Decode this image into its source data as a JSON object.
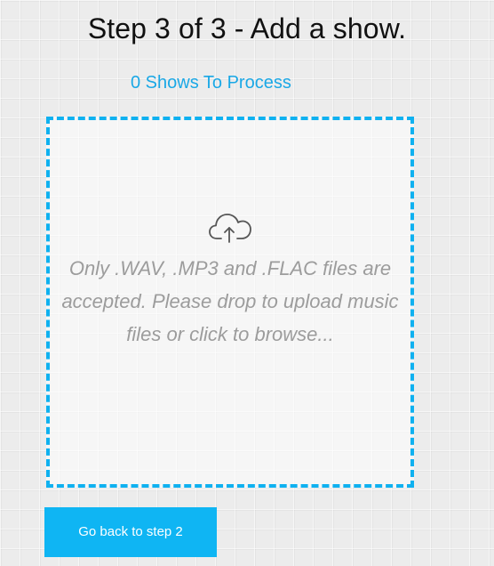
{
  "header": {
    "title": "Step 3 of 3 - Add a show.",
    "shows_count": "0 Shows To Process"
  },
  "dropzone": {
    "icon": "cloud-upload-icon",
    "message": "Only .WAV, .MP3 and .FLAC files are accepted. Please drop to upload music files or click to browse..."
  },
  "footer": {
    "back_button_label": "Go back to step 2"
  },
  "colors": {
    "accent": "#0fb5f3",
    "link_text": "#1aa8e6",
    "placeholder_text": "#9c9c9c",
    "title_text": "#111111"
  }
}
